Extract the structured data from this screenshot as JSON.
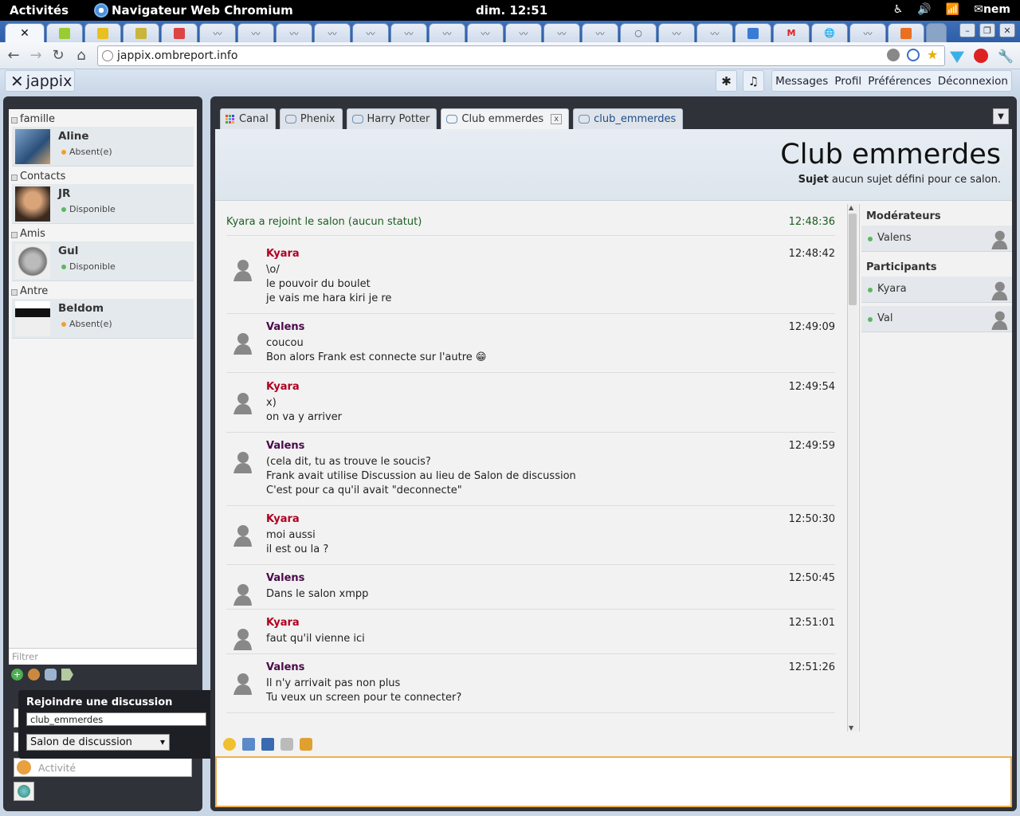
{
  "topbar": {
    "activities": "Activités",
    "app_name": "Navigateur Web Chromium",
    "clock": "dim. 12:51",
    "user": "nem"
  },
  "browser": {
    "url": "jappix.ombreport.info"
  },
  "jappix": {
    "logo_text": "jappix",
    "menu": [
      "Messages",
      "Profil",
      "Préférences",
      "Déconnexion"
    ]
  },
  "roster": {
    "groups": [
      {
        "name": "famille",
        "buddies": [
          {
            "name": "Aline",
            "status": "Absent(e)",
            "presence": "away"
          }
        ]
      },
      {
        "name": "Contacts",
        "buddies": [
          {
            "name": "JR",
            "status": "Disponible",
            "presence": "available"
          }
        ]
      },
      {
        "name": "Amis",
        "buddies": [
          {
            "name": "Gul",
            "status": "Disponible",
            "presence": "available"
          }
        ]
      },
      {
        "name": "Antre",
        "buddies": [
          {
            "name": "Beldom",
            "status": "Absent(e)",
            "presence": "away"
          }
        ]
      }
    ],
    "filter_placeholder": "Filtrer",
    "activity_placeholder": "Activité"
  },
  "join_popup": {
    "title": "Rejoindre une discussion",
    "input_value": "club_emmerdes",
    "type_select": "Salon de discussion"
  },
  "tabs": [
    {
      "label": "Canal",
      "type": "channel"
    },
    {
      "label": "Phenix",
      "type": "chat"
    },
    {
      "label": "Harry Potter",
      "type": "chat"
    },
    {
      "label": "Club emmerdes",
      "type": "chat",
      "selected": true,
      "close": "x"
    },
    {
      "label": "club_emmerdes",
      "type": "chat"
    }
  ],
  "room": {
    "title": "Club emmerdes",
    "subject_label": "Sujet",
    "subject_text": "aucun sujet défini pour ce salon."
  },
  "messages": [
    {
      "system": true,
      "text": "Kyara a rejoint le salon (aucun statut)",
      "time": "12:48:36"
    },
    {
      "nick": "Kyara",
      "time": "12:48:42",
      "lines": [
        "\\o/",
        "le pouvoir du boulet",
        "je vais me hara kiri je re"
      ]
    },
    {
      "nick": "Valens",
      "time": "12:49:09",
      "lines": [
        "coucou",
        "Bon alors Frank est connecte sur l'autre 😁"
      ]
    },
    {
      "nick": "Kyara",
      "time": "12:49:54",
      "lines": [
        "x)",
        "on va y arriver"
      ]
    },
    {
      "nick": "Valens",
      "time": "12:49:59",
      "lines": [
        "(cela dit, tu as trouve le soucis?",
        "Frank avait utilise Discussion au lieu de Salon de discussion",
        "C'est pour ca qu'il avait \"deconnecte\""
      ]
    },
    {
      "nick": "Kyara",
      "time": "12:50:30",
      "lines": [
        "moi aussi",
        "il est ou la ?"
      ]
    },
    {
      "nick": "Valens",
      "time": "12:50:45",
      "lines": [
        "Dans le salon xmpp"
      ]
    },
    {
      "nick": "Kyara",
      "time": "12:51:01",
      "lines": [
        "faut qu'il vienne ici"
      ]
    },
    {
      "nick": "Valens",
      "time": "12:51:26",
      "lines": [
        "Il n'y arrivait pas non plus",
        "Tu veux un screen pour te connecter?"
      ]
    }
  ],
  "occupants": {
    "moderators_label": "Modérateurs",
    "moderators": [
      "Valens"
    ],
    "participants_label": "Participants",
    "participants": [
      "Kyara",
      "Val"
    ]
  },
  "colors": {
    "kyara": "#b00020",
    "valens": "#4a0a4a",
    "compose_border": "#f0b050"
  }
}
